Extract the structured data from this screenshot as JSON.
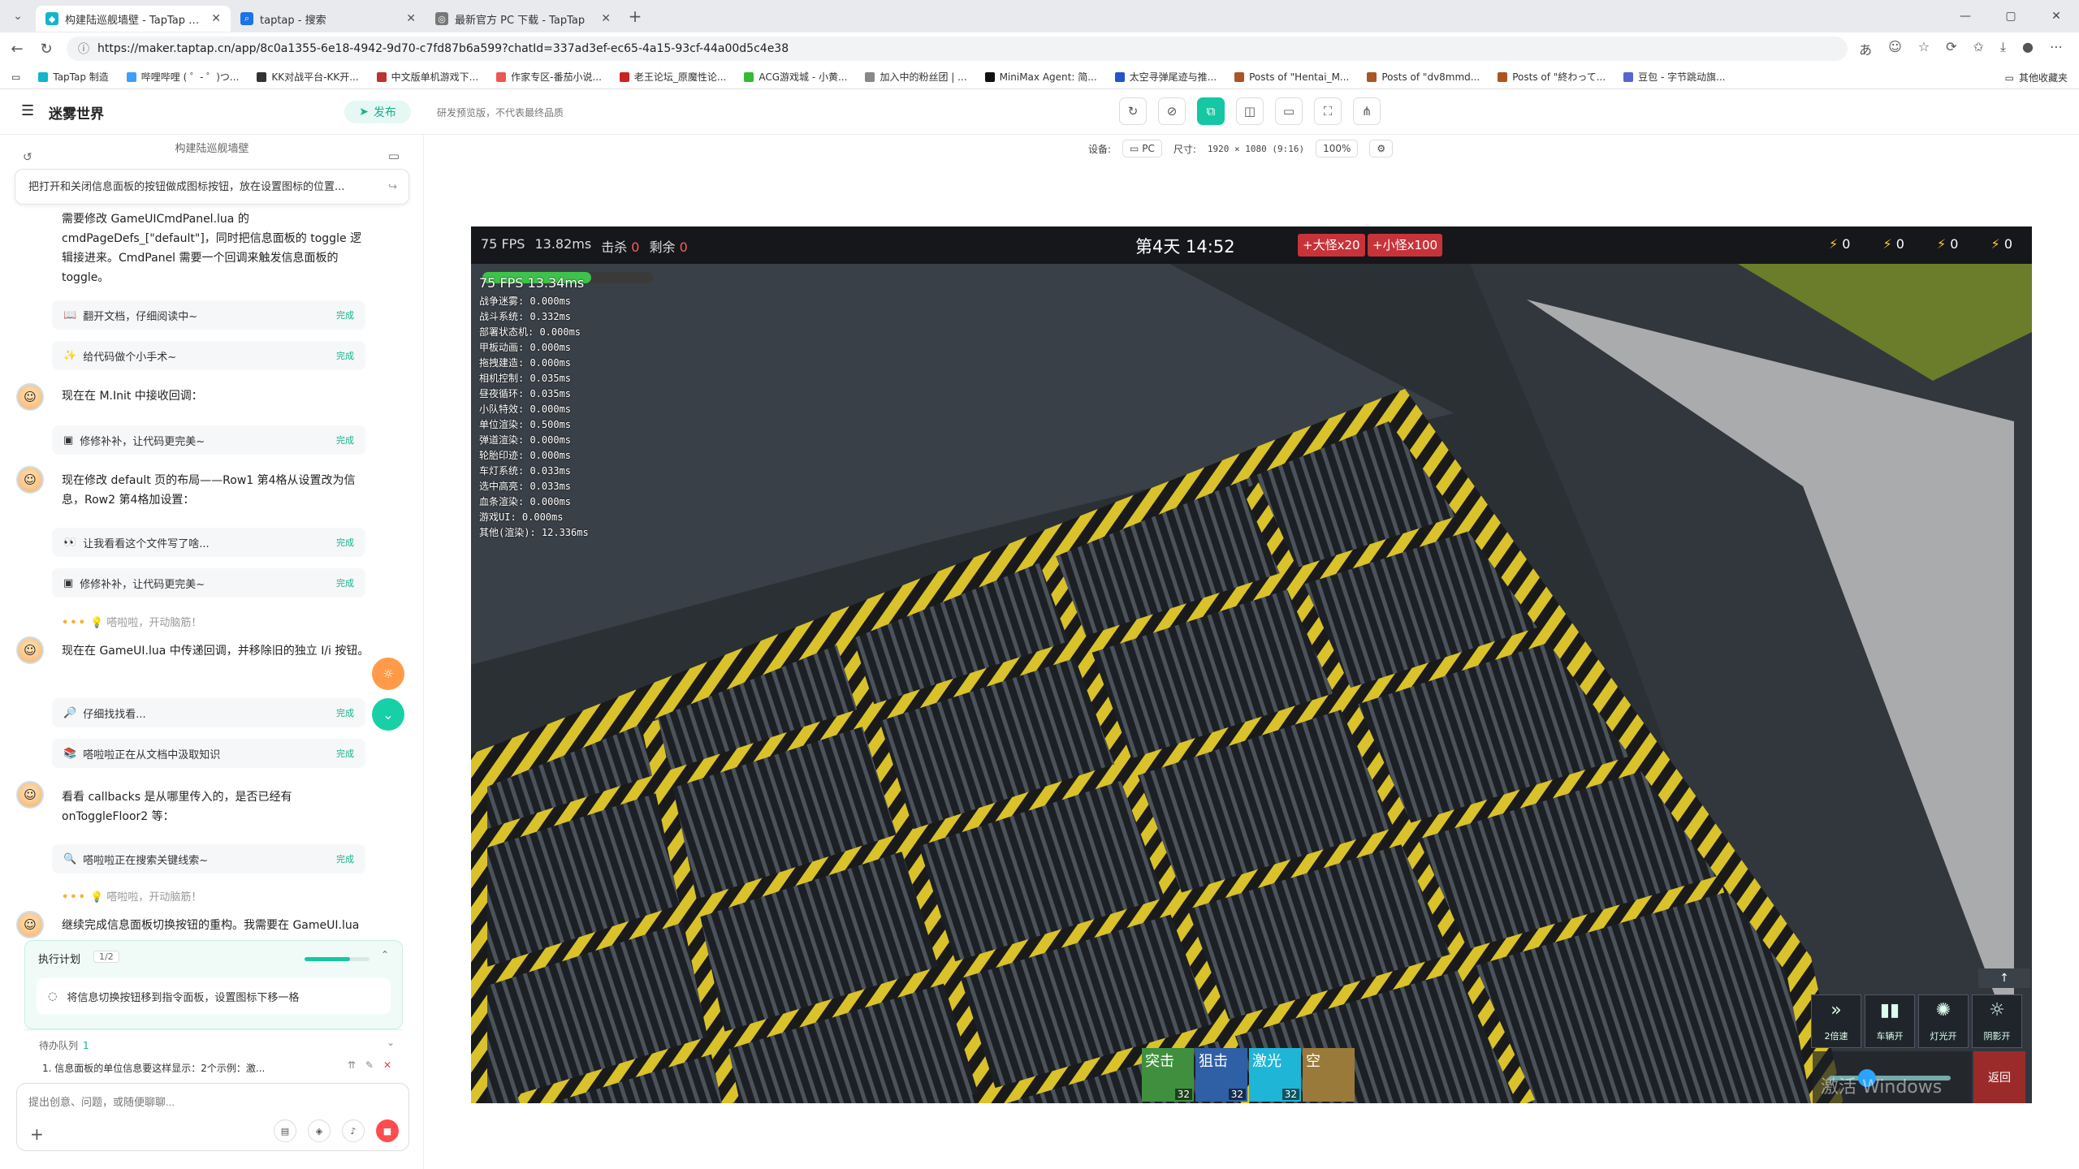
{
  "browser": {
    "tabs": [
      {
        "title": "构建陆巡舰墙壁 - TapTap 制造",
        "active": true,
        "icon_color": "#12b5c9"
      },
      {
        "title": "taptap - 搜索",
        "active": false,
        "icon_color": "#1a73e8"
      },
      {
        "title": "最新官方 PC 下载 - TapTap",
        "active": false,
        "icon_color": "#555555"
      }
    ],
    "url": "https://maker.taptap.cn/app/8c0a1355-6e18-4942-9d70-c7fd87b6a599?chatId=337ad3ef-ec65-4a15-93cf-44a00d5c4e38",
    "bookmarks": [
      "TapTap 制造",
      "哔哩哔哩 ( ゜- ゜)つ...",
      "KK对战平台-KK开...",
      "中文版单机游戏下...",
      "作家专区-番茄小说...",
      "老王论坛_原魔性论...",
      "ACG游戏城 - 小黄...",
      "加入中的粉丝团 | ...",
      "MiniMax Agent: 简...",
      "太空寻弹尾迹与推...",
      "Posts of \"Hentai_M...",
      "Posts of \"dv8mmd...",
      "Posts of \"終わって...",
      "豆包 - 字节跳动旗..."
    ],
    "bookmarks_other": "其他收藏夹"
  },
  "header": {
    "project_title": "迷雾世界",
    "publish_label": "发布",
    "preview_note": "研发预览版，不代表最终品质"
  },
  "sidebar": {
    "conversation_title": "构建陆巡舰墙壁",
    "pinned_prompt": "把打开和关闭信息面板的按钮做成图标按钮，放在设置图标的位置...",
    "msg1": "需要修改 GameUICmdPanel.lua 的 cmdPageDefs_[\"default\"]，同时把信息面板的 toggle 逻辑接进来。CmdPanel 需要一个回调来触发信息面板的 toggle。",
    "msg2": "现在在 M.Init 中接收回调：",
    "msg3": "现在修改 default 页的布局——Row1 第4格从设置改为信息，Row2 第4格加设置：",
    "msg4": "现在在 GameUI.lua 中传递回调，并移除旧的独立 I/i 按钮。",
    "msg5": "看看 callbacks 是从哪里传入的，是否已经有 onToggleFloor2 等：",
    "msg6": "继续完成信息面板切换按钮的重构。我需要在 GameUI.lua",
    "steps": [
      {
        "label": "翻开文档，仔细阅读中~",
        "status": "完成"
      },
      {
        "label": "给代码做个小手术~",
        "status": "完成"
      },
      {
        "label": "修修补补，让代码更完美~",
        "status": "完成"
      },
      {
        "label": "让我看看这个文件写了啥...",
        "status": "完成"
      },
      {
        "label": "修修补补，让代码更完美~",
        "status": "完成"
      },
      {
        "label": "仔细找找看...",
        "status": "完成"
      },
      {
        "label": "嗒啦啦正在从文档中汲取知识",
        "status": "完成"
      },
      {
        "label": "嗒啦啦正在搜索关键线索~",
        "status": "完成"
      }
    ],
    "thinking": "嗒啦啦，开动脑筋！",
    "plan_title": "执行计划",
    "plan_count": "1/2",
    "plan_progress": 0.7,
    "plan_task": "将信息切换按钮移到指令面板，设置图标下移一格",
    "queue_title": "待办队列",
    "queue_count": "1",
    "queue_item": "1.  信息面板的单位信息要这样显示：2个示例：激...",
    "composer_placeholder": "提出创意、问题，或随便聊聊..."
  },
  "preview": {
    "device_label": "设备:",
    "device": "PC",
    "size_label": "尺寸:",
    "size": "1920 × 1080 (9:16)",
    "zoom": "100%"
  },
  "game": {
    "fps": "75 FPS",
    "frame_ms": "13.82ms",
    "kills_label": "击杀",
    "kills": "0",
    "remain_label": "剩余",
    "remain": "0",
    "day": "第4天 14:52",
    "badge_big": "+大怪x20",
    "badge_small": "+小怪x100",
    "energy": [
      "0",
      "0",
      "0",
      "0"
    ],
    "hp_fraction": 0.64,
    "perf_fps": "75 FPS  13.34ms",
    "perf_lines": [
      "战争迷雾: 0.000ms",
      "战斗系统: 0.332ms",
      "部署状态机: 0.000ms",
      "甲板动画: 0.000ms",
      "拖拽建造: 0.000ms",
      "相机控制: 0.035ms",
      "昼夜循环: 0.035ms",
      "小队特效: 0.000ms",
      "单位渲染: 0.500ms",
      "弹道渲染: 0.000ms",
      "轮胎印迹: 0.000ms",
      "车灯系统: 0.033ms",
      "选中高亮: 0.033ms",
      "血条渲染: 0.000ms",
      "游戏UI: 0.000ms",
      "其他(渲染): 12.336ms"
    ],
    "cards": [
      {
        "label": "突击",
        "count": "32",
        "color": "#3f8f3f"
      },
      {
        "label": "狙击",
        "count": "32",
        "color": "#2f5fa5"
      },
      {
        "label": "激光",
        "count": "32",
        "color": "#1fb5d6"
      },
      {
        "label": "空",
        "count": "",
        "color": "#9a7a3a"
      }
    ],
    "skills": [
      {
        "label": "2倍速",
        "icon": "»"
      },
      {
        "label": "车辆开",
        "icon": "▮▮"
      },
      {
        "label": "灯光开",
        "icon": "✺"
      },
      {
        "label": "阴影开",
        "icon": "☼"
      }
    ],
    "speed_slider": 0.24,
    "return_label": "返回",
    "watermark": "激活 Windows",
    "up_arrow": "↑"
  }
}
